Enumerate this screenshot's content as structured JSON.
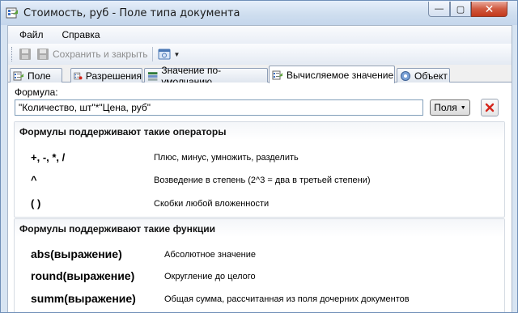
{
  "window": {
    "title": "Стоимость, руб - Поле типа документа",
    "buttons": {
      "minimize": "—",
      "maximize": "▢",
      "close": "✕"
    }
  },
  "menu": {
    "items": [
      "Файл",
      "Справка"
    ]
  },
  "toolbar": {
    "save_close_label": "Сохранить и закрыть"
  },
  "tabs": [
    {
      "label": "Поле",
      "icon": "field-icon",
      "active": false
    },
    {
      "label": "Разрешения",
      "icon": "permissions-icon",
      "active": false
    },
    {
      "label": "Значение по-умолчанию",
      "icon": "default-value-icon",
      "active": false
    },
    {
      "label": "Вычисляемое значение",
      "icon": "calculated-value-icon",
      "active": true
    },
    {
      "label": "Объект",
      "icon": "object-icon",
      "active": false
    }
  ],
  "formula": {
    "label": "Формула:",
    "value": "\"Количество, шт\"*\"Цена, руб\"",
    "fields_button": "Поля"
  },
  "operators": {
    "title": "Формулы поддерживают такие операторы",
    "items": [
      {
        "code": "+, -, *, /",
        "desc": "Плюс, минус, умножить, разделить"
      },
      {
        "code": "^",
        "desc": "Возведение в степень (2^3 = два в третьей степени)"
      },
      {
        "code": "( )",
        "desc": "Скобки любой вложенности"
      }
    ]
  },
  "functions": {
    "title": "Формулы поддерживают такие функции",
    "items": [
      {
        "code": "abs(выражение)",
        "desc": "Абсолютное значение"
      },
      {
        "code": "round(выражение)",
        "desc": "Округление до целого"
      },
      {
        "code": "summ(выражение)",
        "desc": "Общая сумма, рассчитанная из поля дочерних документов"
      }
    ]
  },
  "colors": {
    "title_bar": "#cfdeef",
    "close_button": "#c3391c",
    "accent_red": "#d4261c"
  }
}
